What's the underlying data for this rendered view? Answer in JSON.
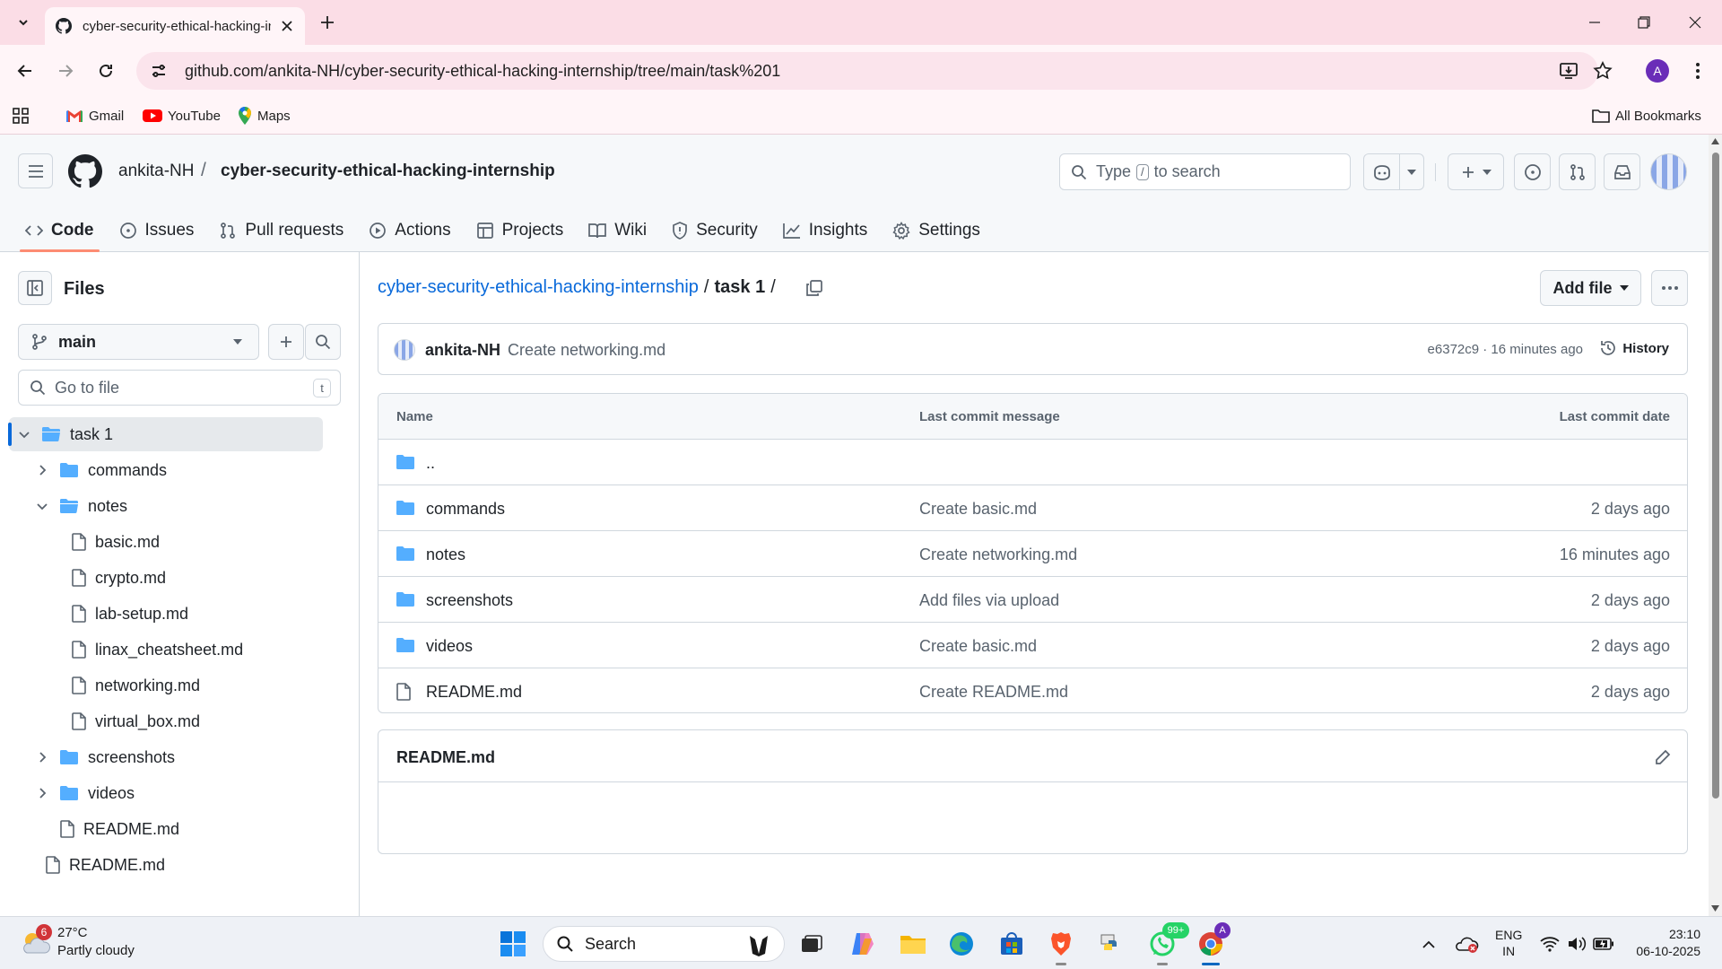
{
  "browser": {
    "tab_title": "cyber-security-ethical-hacking-internship",
    "url": "github.com/ankita-NH/cyber-security-ethical-hacking-internship/tree/main/task%201",
    "profile_initial": "A",
    "bookmarks": [
      {
        "label": "Gmail",
        "icon": "gmail-icon"
      },
      {
        "label": "YouTube",
        "icon": "youtube-icon"
      },
      {
        "label": "Maps",
        "icon": "maps-icon"
      }
    ],
    "all_bookmarks": "All Bookmarks"
  },
  "github": {
    "owner": "ankita-NH",
    "slash": "/",
    "repo": "cyber-security-ethical-hacking-internship",
    "search_before": "Type",
    "search_key": "/",
    "search_after": "to search",
    "nav": [
      {
        "label": "Code",
        "icon": "code-icon",
        "active": true
      },
      {
        "label": "Issues",
        "icon": "issue-icon"
      },
      {
        "label": "Pull requests",
        "icon": "pull-request-icon"
      },
      {
        "label": "Actions",
        "icon": "play-icon"
      },
      {
        "label": "Projects",
        "icon": "table-icon"
      },
      {
        "label": "Wiki",
        "icon": "book-icon"
      },
      {
        "label": "Security",
        "icon": "shield-icon"
      },
      {
        "label": "Insights",
        "icon": "graph-icon"
      },
      {
        "label": "Settings",
        "icon": "gear-icon"
      }
    ]
  },
  "sidebar": {
    "title": "Files",
    "branch": "main",
    "goto_placeholder": "Go to file",
    "goto_key": "t",
    "tree": [
      {
        "label": "task 1",
        "type": "folder-open",
        "depth": 0,
        "chevron": "down",
        "selected": true
      },
      {
        "label": "commands",
        "type": "folder",
        "depth": 1,
        "chevron": "right"
      },
      {
        "label": "notes",
        "type": "folder-open",
        "depth": 1,
        "chevron": "down"
      },
      {
        "label": "basic.md",
        "type": "file",
        "depth": 2
      },
      {
        "label": "crypto.md",
        "type": "file",
        "depth": 2
      },
      {
        "label": "lab-setup.md",
        "type": "file",
        "depth": 2
      },
      {
        "label": "linax_cheatsheet.md",
        "type": "file",
        "depth": 2
      },
      {
        "label": "networking.md",
        "type": "file",
        "depth": 2
      },
      {
        "label": "virtual_box.md",
        "type": "file",
        "depth": 2
      },
      {
        "label": "screenshots",
        "type": "folder",
        "depth": 1,
        "chevron": "right"
      },
      {
        "label": "videos",
        "type": "folder",
        "depth": 1,
        "chevron": "right"
      },
      {
        "label": "README.md",
        "type": "file",
        "depth": 1
      },
      {
        "label": "README.md",
        "type": "file",
        "depth": 0
      }
    ]
  },
  "main": {
    "breadcrumb_repo": "cyber-security-ethical-hacking-internship",
    "breadcrumb_sep": "/",
    "breadcrumb_current": "task 1",
    "breadcrumb_trail": "/",
    "add_file": "Add file",
    "commit": {
      "author": "ankita-NH",
      "message": "Create networking.md",
      "meta": "e6372c9 · 16 minutes ago",
      "history": "History"
    },
    "table": {
      "headers": {
        "name": "Name",
        "message": "Last commit message",
        "date": "Last commit date"
      },
      "rows": [
        {
          "name": "..",
          "type": "folder",
          "message": "",
          "date": ""
        },
        {
          "name": "commands",
          "type": "folder",
          "message": "Create basic.md",
          "date": "2 days ago"
        },
        {
          "name": "notes",
          "type": "folder",
          "message": "Create networking.md",
          "date": "16 minutes ago"
        },
        {
          "name": "screenshots",
          "type": "folder",
          "message": "Add files via upload",
          "date": "2 days ago"
        },
        {
          "name": "videos",
          "type": "folder",
          "message": "Create basic.md",
          "date": "2 days ago"
        },
        {
          "name": "README.md",
          "type": "file",
          "message": "Create README.md",
          "date": "2 days ago"
        }
      ]
    },
    "readme_title": "README.md"
  },
  "taskbar": {
    "weather_badge": "6",
    "temperature": "27°C",
    "condition": "Partly cloudy",
    "search_placeholder": "Search",
    "whatsapp_badge": "99+",
    "chrome_badge": "A",
    "lang_line1": "ENG",
    "lang_line2": "IN",
    "time": "23:10",
    "date": "06-10-2025"
  },
  "colors": {
    "accent_link": "#0969da",
    "folder": "#54aeff",
    "nav_underline": "#fd8c73",
    "chrome_tabstrip": "#fbdde6"
  }
}
